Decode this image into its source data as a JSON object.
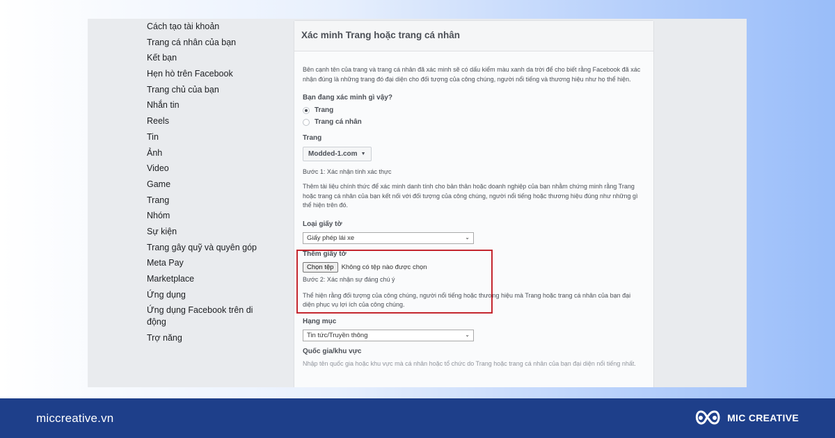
{
  "sidebar": {
    "items": [
      "Cách tạo tài khoản",
      "Trang cá nhân của bạn",
      "Kết bạn",
      "Hẹn hò trên Facebook",
      "Trang chủ của bạn",
      "Nhắn tin",
      "Reels",
      "Tin",
      "Ảnh",
      "Video",
      "Game",
      "Trang",
      "Nhóm",
      "Sự kiện",
      "Trang gây quỹ và quyên góp",
      "Meta Pay",
      "Marketplace",
      "Ứng dụng",
      "Ứng dụng Facebook trên di động",
      "Trợ năng"
    ]
  },
  "panel": {
    "title": "Xác minh Trang hoặc trang cá nhân",
    "description": "Bên cạnh tên của trang và trang cá nhân đã xác minh sẽ có dấu kiểm màu xanh da trời để cho biết rằng Facebook đã xác nhận đúng là những trang đó đại diện cho đối tượng của công chúng, người nổi tiếng và thương hiệu như họ thể hiện.",
    "question": "Bạn đang xác minh gì vậy?",
    "options": [
      "Trang",
      "Trang cá nhân"
    ],
    "selected_option": "Trang",
    "page_label": "Trang",
    "page_value": "Modded-1.com",
    "step1": "Bước 1: Xác nhận tính xác thực",
    "step1_desc": "Thêm tài liệu chính thức để xác minh danh tính cho bản thân hoặc doanh nghiệp của bạn nhằm chứng minh rằng Trang hoặc trang cá nhân của bạn kết nối với đối tượng của công chúng, người nổi tiếng hoặc thương hiệu đúng như những gì thể hiện trên đó.",
    "doc_type_label": "Loại giấy tờ",
    "doc_type_value": "Giấy phép lái xe",
    "add_doc_label": "Thêm giấy tờ",
    "choose_file_button": "Chọn tệp",
    "no_file_text": "Không có tệp nào được chọn",
    "step2": "Bước 2: Xác nhận sự đáng chú ý",
    "step2_desc": "Thể hiện rằng đối tượng của công chúng, người nổi tiếng hoặc thương hiệu mà Trang hoặc trang cá nhân của bạn đại diện phục vụ lợi ích của công chúng.",
    "category_label": "Hạng mục",
    "category_value": "Tin tức/Truyền thông",
    "country_label": "Quốc gia/khu vực",
    "country_desc": "Nhập tên quốc gia hoặc khu vực mà cá nhân hoặc tổ chức do Trang hoặc trang cá nhân của bạn đại diện nổi tiếng nhất."
  },
  "footer": {
    "url": "miccreative.vn",
    "brand": "MIC CREATIVE"
  },
  "colors": {
    "footer_bg": "#1e3f8a",
    "highlight": "#c4262e"
  }
}
